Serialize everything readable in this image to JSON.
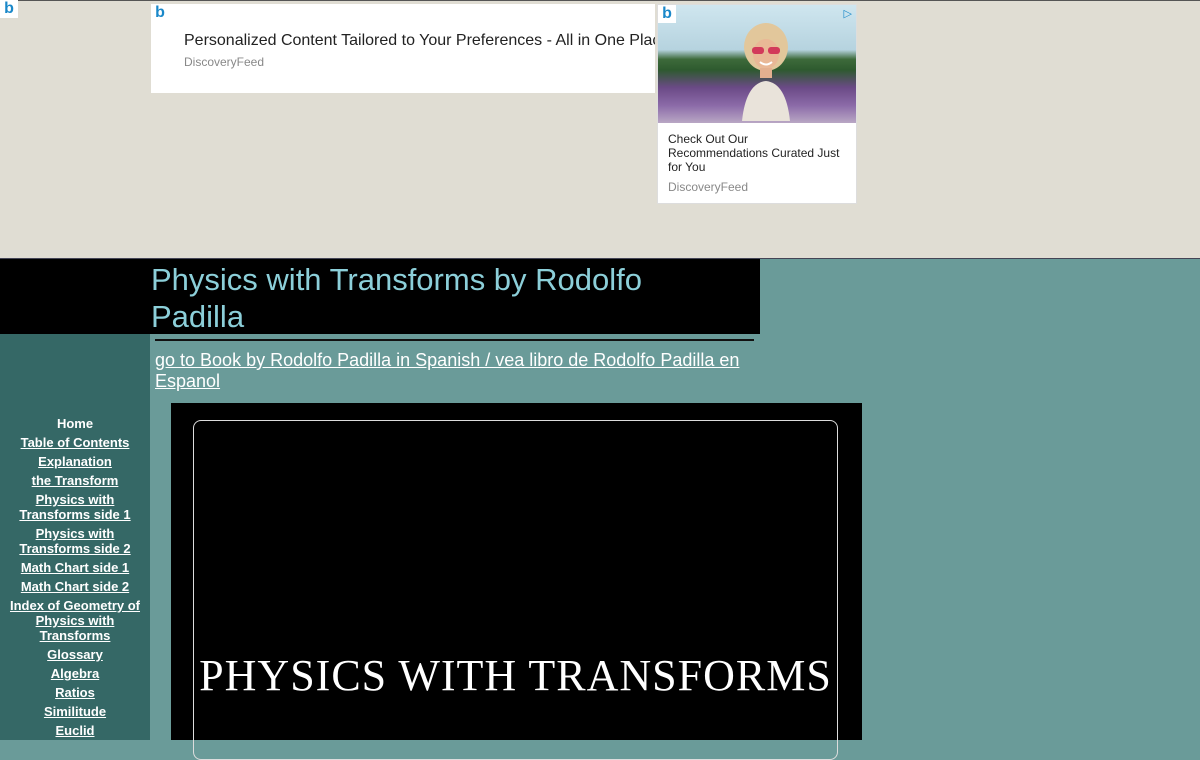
{
  "ads": {
    "banner": {
      "headline": "Personalized Content Tailored to Your Preferences - All in One Place",
      "source": "DiscoveryFeed"
    },
    "card": {
      "text": "Check Out Our Recommendations Curated Just for You",
      "source": "DiscoveryFeed",
      "adchoices_icon": "adchoices-triangle-icon"
    },
    "icon_letter": "b"
  },
  "header": {
    "title": "Physics with Transforms by Rodolfo Padilla"
  },
  "spanish_link": "go to Book by Rodolfo Padilla in Spanish / vea libro de Rodolfo Padilla en Espanol",
  "nav": {
    "items": [
      "Home",
      "Table of Contents",
      "Explanation",
      "the Transform",
      "Physics with Transforms side 1",
      "Physics with Transforms side 2",
      "Math Chart side 1",
      "Math Chart side 2",
      "Index of Geometry of Physics with Transforms",
      "Glossary",
      "Algebra",
      "Ratios",
      "Similitude",
      "Euclid"
    ]
  },
  "book": {
    "title": "PHYSICS WITH TRANSFORMS"
  },
  "colors": {
    "page_bg": "#6a9b99",
    "sidebar_bg": "#356866",
    "ad_bg": "#e0ddd3",
    "title_text": "#8ccfd9"
  }
}
